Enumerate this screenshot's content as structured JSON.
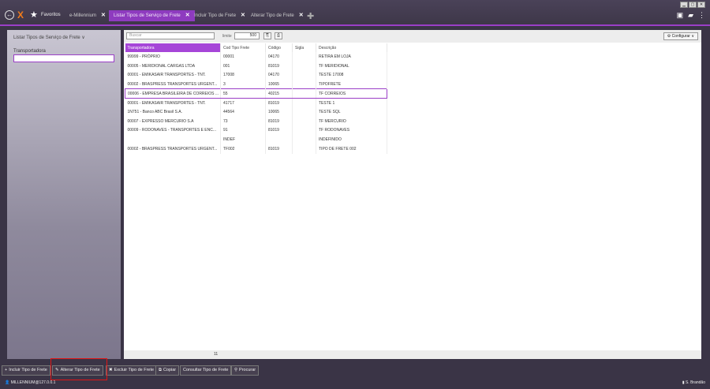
{
  "window": {
    "controls": [
      "▁",
      "▢",
      "✕"
    ]
  },
  "topbar": {
    "back_icon": "back-arrow-icon",
    "logo": "X",
    "favorites_label": "Favoritos",
    "tabs": [
      {
        "label": "e-Millennium",
        "active": false
      },
      {
        "label": "Listar Tipos de Serviço de Frete",
        "active": true
      },
      {
        "label": "Incluir Tipo de Frete",
        "active": false
      },
      {
        "label": "Alterar Tipo de Frete",
        "active": false
      }
    ],
    "right_icons": [
      "clipboard-icon",
      "chat-icon",
      "more-vert-icon"
    ]
  },
  "filter_panel": {
    "title": "Listar Tipos de Serviço de Frete ∨",
    "transportadora_label": "Transportadora",
    "transportadora_value": ""
  },
  "grid_toolbar": {
    "search_placeholder": "Buscar",
    "limit_label": "limite",
    "limit_value": "500",
    "configure_label": "Configurar ∨"
  },
  "grid": {
    "columns": [
      "Transportadora",
      "Cod Tipo Frete",
      "Código",
      "Sigla",
      "Descrição"
    ],
    "rows": [
      [
        "99999 - PRÓPRIO",
        "00001",
        "04170",
        "",
        "RETIRA EM LOJA"
      ],
      [
        "00005 - MERIDIONAL CARGAS LTDA",
        "001",
        "81019",
        "",
        "TF MERIDIONAL"
      ],
      [
        "00001 - EMIKASAIR TRANSPORTES - TNT.",
        "17008",
        "04170",
        "",
        "TESTE 17008"
      ],
      [
        "00002 - BRASPRESS TRANSPORTES URGENT...",
        "3",
        "10065",
        "",
        "TIPOFRETE"
      ],
      [
        "00006 - EMPRESA BRASILEIRA DE CORREIOS ...",
        "55",
        "40215",
        "",
        "TF CORREIOS"
      ],
      [
        "00001 - EMIKASAIR TRANSPORTES - TNT.",
        "41717",
        "81019",
        "",
        "TESTE 1"
      ],
      [
        "1N751 - Banco ABC Brasil S.A.",
        "44564",
        "10065",
        "",
        "TESTE SQL"
      ],
      [
        "00007 - EXPRESSO MERCURIO S.A",
        "73",
        "81019",
        "",
        "TF MERCURIO"
      ],
      [
        "00009 - RODONAVES - TRANSPORTES E ENC...",
        "91",
        "81019",
        "",
        "TF RODONAVES"
      ],
      [
        "",
        "INDEF",
        "",
        "",
        "INDEFINIDO"
      ],
      [
        "00002 - BRASPRESS TRANSPORTES URGENT...",
        "TF002",
        "81019",
        "",
        "TIPO DE FRETE 002"
      ]
    ],
    "selected_row": 4,
    "record_count": "11"
  },
  "actions": [
    {
      "label": "Incluir Tipo de Frete",
      "icon": "+"
    },
    {
      "label": "Alterar Tipo de Frete",
      "icon": "✎"
    },
    {
      "label": "Excluir Tipo de Frete",
      "icon": "✖"
    },
    {
      "label": "Copiar",
      "icon": "⧉"
    },
    {
      "label": "Consultar Tipo de Frete",
      "icon": ""
    },
    {
      "label": "Procurar",
      "icon": "⚲"
    }
  ],
  "status": {
    "connection": "MILLENNIUM@127.0.0.1",
    "user": "S. Brandão"
  }
}
